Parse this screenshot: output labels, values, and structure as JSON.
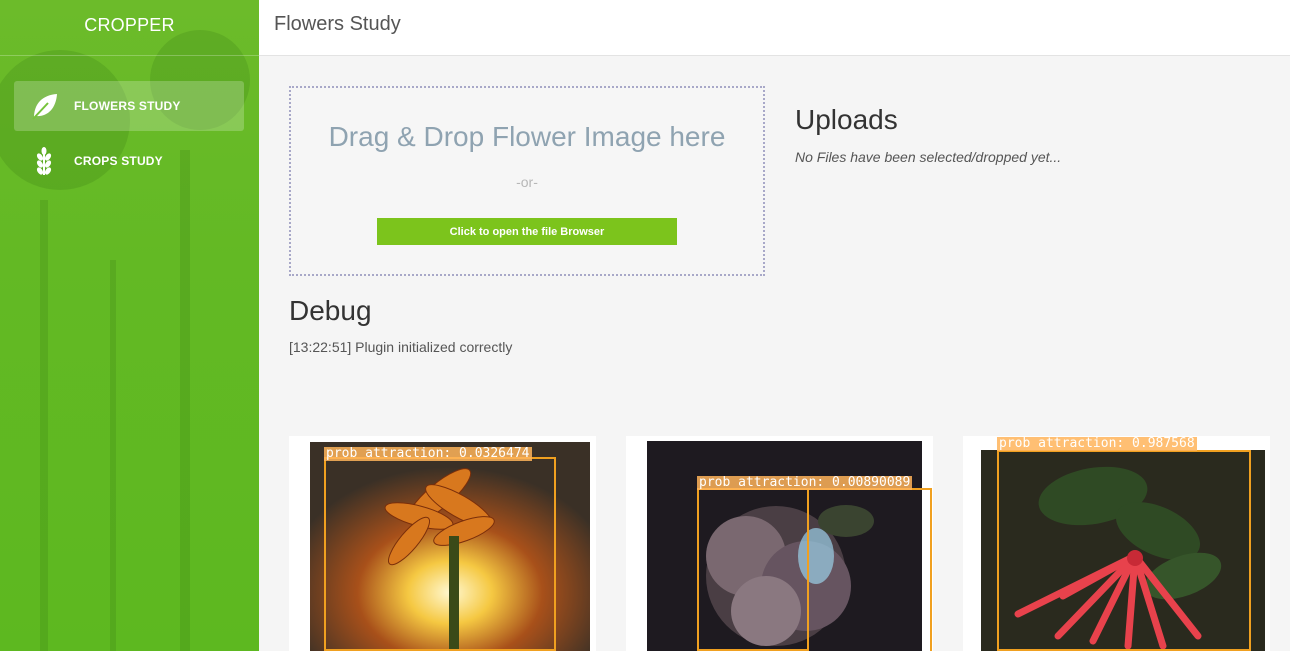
{
  "app": {
    "brand": "CROPPER"
  },
  "sidebar": {
    "items": [
      {
        "label": "FLOWERS STUDY",
        "icon": "leaf-icon",
        "active": true
      },
      {
        "label": "CROPS STUDY",
        "icon": "wheat-icon",
        "active": false
      }
    ]
  },
  "header": {
    "title": "Flowers Study"
  },
  "dropzone": {
    "title": "Drag & Drop Flower Image here",
    "or": "-or-",
    "button": "Click to open the file Browser"
  },
  "uploads": {
    "title": "Uploads",
    "empty": "No Files have been selected/dropped yet..."
  },
  "debug": {
    "title": "Debug",
    "lines": [
      "[13:22:51] Plugin initialized correctly"
    ]
  },
  "results": [
    {
      "label": "prob attraction: 0.0326474",
      "image": "orange-dried-flower"
    },
    {
      "label": "prob attraction: 0.00890089",
      "image": "dark-rose"
    },
    {
      "label": "prob attraction: 0.987568",
      "image": "red-tubular-flowers"
    }
  ],
  "colors": {
    "sidebar": "#63b924",
    "button": "#7cc41c",
    "box": "#f0a020"
  }
}
